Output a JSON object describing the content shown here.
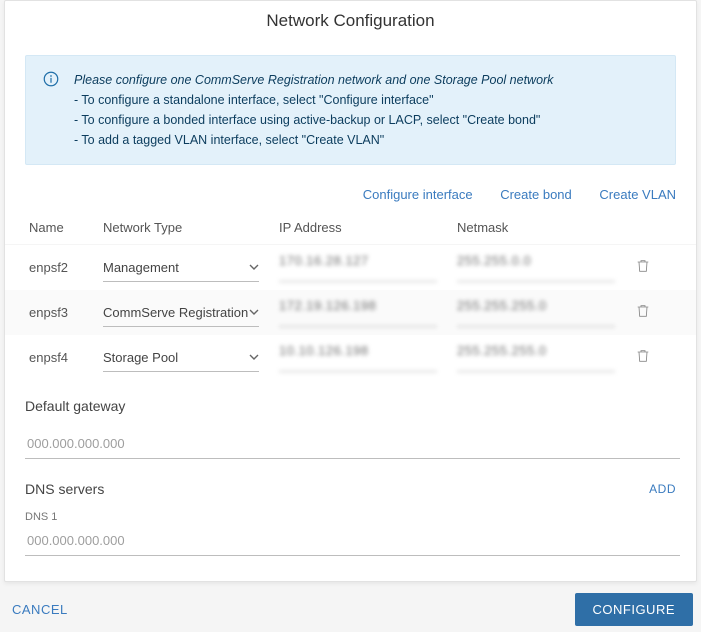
{
  "title": "Network Configuration",
  "info": {
    "lead": "Please configure one CommServe Registration network and one Storage Pool network",
    "lines": [
      "- To configure a standalone interface, select \"Configure interface\"",
      "- To configure a bonded interface using active-backup or LACP, select \"Create bond\"",
      "- To add a tagged VLAN interface, select \"Create VLAN\""
    ]
  },
  "actions": {
    "configure_interface": "Configure interface",
    "create_bond": "Create bond",
    "create_vlan": "Create VLAN"
  },
  "columns": {
    "name": "Name",
    "type": "Network Type",
    "ip": "IP Address",
    "mask": "Netmask"
  },
  "interfaces": [
    {
      "name": "enpsf2",
      "type": "Management",
      "ip": "170.16.28.127",
      "mask": "255.255.0.0"
    },
    {
      "name": "enpsf3",
      "type": "CommServe Registration",
      "ip": "172.19.126.198",
      "mask": "255.255.255.0"
    },
    {
      "name": "enpsf4",
      "type": "Storage Pool",
      "ip": "10.10.126.198",
      "mask": "255.255.255.0"
    }
  ],
  "gateway": {
    "label": "Default gateway",
    "placeholder": "000.000.000.000"
  },
  "dns": {
    "label": "DNS servers",
    "add": "ADD",
    "entries": [
      {
        "label": "DNS 1",
        "placeholder": "000.000.000.000"
      }
    ]
  },
  "footer": {
    "cancel": "CANCEL",
    "submit": "CONFIGURE"
  }
}
